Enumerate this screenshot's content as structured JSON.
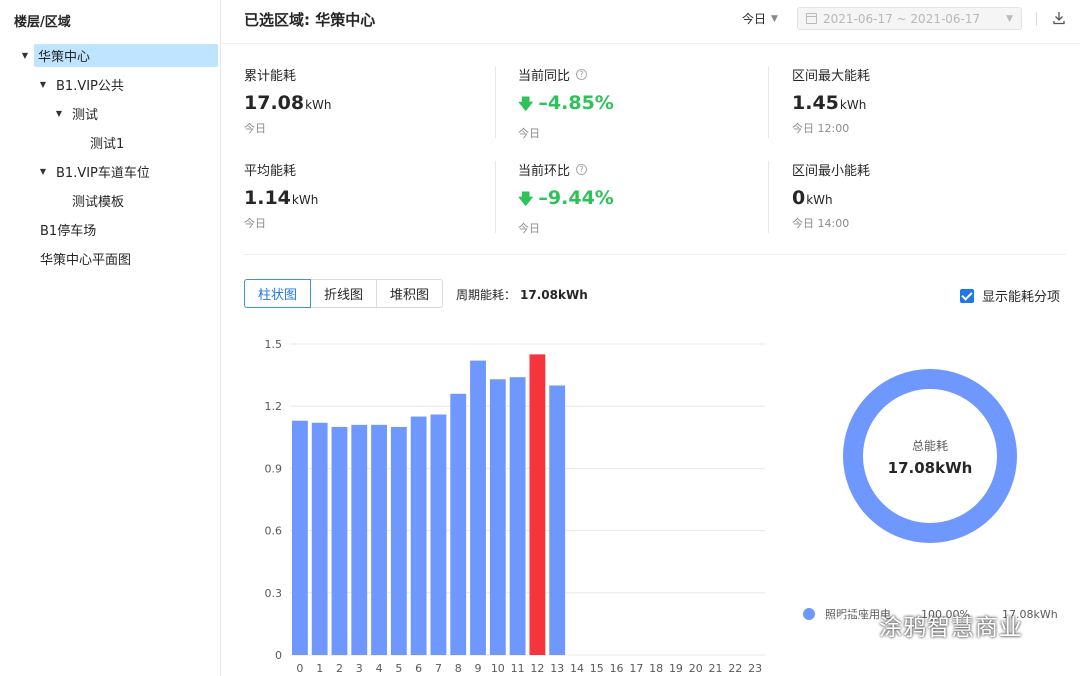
{
  "sidebar": {
    "title": "楼层/区域",
    "items": [
      {
        "label": "华策中心",
        "level": 0,
        "expanded": true,
        "selected": true
      },
      {
        "label": "B1.VIP公共",
        "level": 1,
        "expanded": true
      },
      {
        "label": "测试",
        "level": 2,
        "expanded": true
      },
      {
        "label": "测试1",
        "level": 3,
        "leaf": true
      },
      {
        "label": "B1.VIP车道车位",
        "level": 1,
        "expanded": true
      },
      {
        "label": "测试模板",
        "level": 2,
        "leaf": true
      },
      {
        "label": "B1停车场",
        "level": 0,
        "leaf": true
      },
      {
        "label": "华策中心平面图",
        "level": 0,
        "leaf": true
      }
    ]
  },
  "header": {
    "title": "已选区域: 华策中心",
    "period": "今日",
    "date_range": "2021-06-17 ~ 2021-06-17"
  },
  "stats": [
    {
      "label": "累计能耗",
      "value": "17.08",
      "unit": "kWh",
      "sub": "今日",
      "help": false,
      "trend": ""
    },
    {
      "label": "当前同比",
      "value": "–4.85%",
      "unit": "",
      "sub": "今日",
      "help": true,
      "trend": "down"
    },
    {
      "label": "区间最大能耗",
      "value": "1.45",
      "unit": "kWh",
      "sub": "今日 12:00",
      "help": false,
      "trend": ""
    },
    {
      "label": "平均能耗",
      "value": "1.14",
      "unit": "kWh",
      "sub": "今日",
      "help": false,
      "trend": ""
    },
    {
      "label": "当前环比",
      "value": "–9.44%",
      "unit": "",
      "sub": "今日",
      "help": true,
      "trend": "down"
    },
    {
      "label": "区间最小能耗",
      "value": "0",
      "unit": "kWh",
      "sub": "今日 14:00",
      "help": false,
      "trend": ""
    }
  ],
  "chart_tabs": [
    "柱状图",
    "折线图",
    "堆积图"
  ],
  "active_tab": 0,
  "period_total": {
    "label": "周期能耗：",
    "value": "17.08kWh"
  },
  "show_items": {
    "label": "显示能耗分项",
    "checked": true
  },
  "colors": {
    "bar": "#6f98ff",
    "highlight": "#f5343b",
    "accent": "#1f77e8",
    "down": "#2fc25b"
  },
  "chart_data": [
    {
      "type": "bar",
      "categories": [
        "0",
        "1",
        "2",
        "3",
        "4",
        "5",
        "6",
        "7",
        "8",
        "9",
        "10",
        "11",
        "12",
        "13",
        "14",
        "15",
        "16",
        "17",
        "18",
        "19",
        "20",
        "21",
        "22",
        "23"
      ],
      "values": [
        1.13,
        1.12,
        1.1,
        1.11,
        1.11,
        1.1,
        1.15,
        1.16,
        1.26,
        1.42,
        1.33,
        1.34,
        1.45,
        1.3,
        null,
        null,
        null,
        null,
        null,
        null,
        null,
        null,
        null,
        null
      ],
      "highlight_index": 12,
      "ylim": [
        0,
        1.5
      ],
      "yticks": [
        "0",
        "0.3",
        "0.6",
        "0.9",
        "1.2",
        "1.5"
      ],
      "grid": true
    },
    {
      "type": "pie",
      "center_label": "总能耗",
      "center_value": "17.08kWh",
      "slices": [
        {
          "name": "照明插座用电",
          "percent": "100.00%",
          "value": "17.08kWh",
          "share": 1.0
        }
      ]
    }
  ],
  "watermark": "涂鸦智慧商业"
}
